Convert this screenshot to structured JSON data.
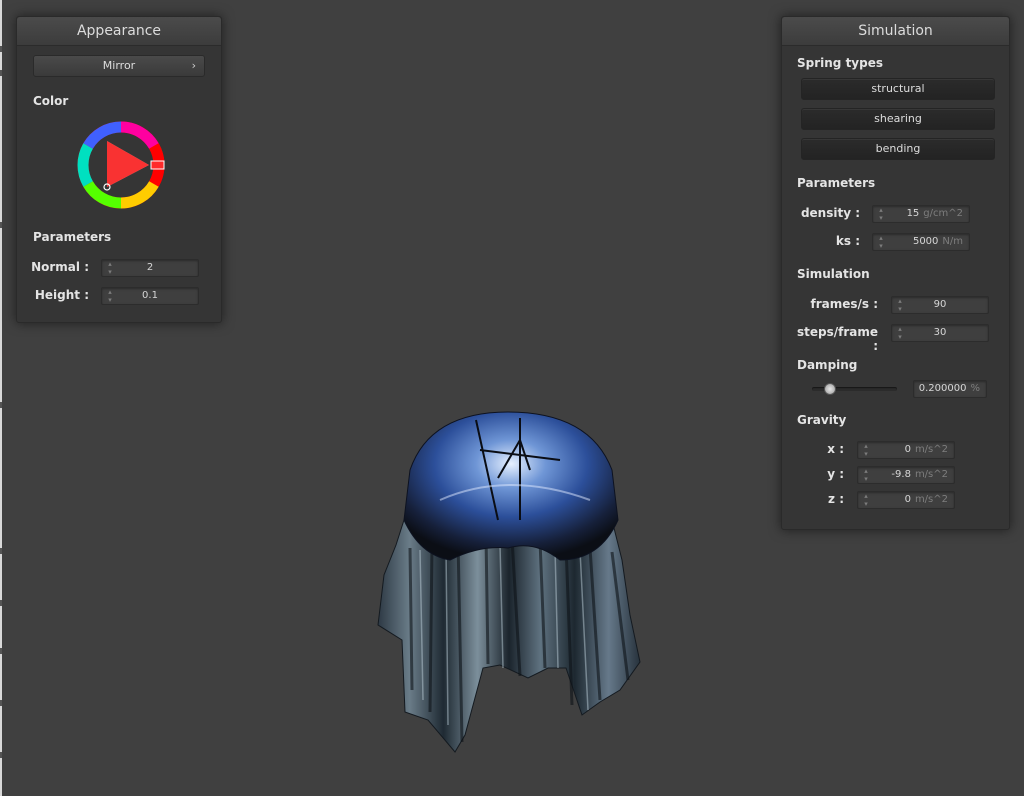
{
  "appearance": {
    "title": "Appearance",
    "shader_dropdown": "Mirror",
    "color_label": "Color",
    "color": "#ff0000",
    "parameters_label": "Parameters",
    "normal": {
      "label": "Normal :",
      "value": "2"
    },
    "height": {
      "label": "Height :",
      "value": "0.1"
    }
  },
  "simulation": {
    "title": "Simulation",
    "spring_types_label": "Spring types",
    "springs": {
      "structural": "structural",
      "shearing": "shearing",
      "bending": "bending"
    },
    "parameters_label": "Parameters",
    "density": {
      "label": "density :",
      "value": "15",
      "unit": "g/cm^2"
    },
    "ks": {
      "label": "ks :",
      "value": "5000",
      "unit": "N/m"
    },
    "simulation_label": "Simulation",
    "fps": {
      "label": "frames/s :",
      "value": "90"
    },
    "steps": {
      "label": "steps/frame :",
      "value": "30"
    },
    "damping_label": "Damping",
    "damping": {
      "value": "0.200000",
      "unit": "%",
      "fraction": 0.2
    },
    "gravity_label": "Gravity",
    "gx": {
      "label": "x :",
      "value": "0",
      "unit": "m/s^2"
    },
    "gy": {
      "label": "y :",
      "value": "-9.8",
      "unit": "m/s^2"
    },
    "gz": {
      "label": "z :",
      "value": "0",
      "unit": "m/s^2"
    }
  },
  "icons": {
    "dropdown": "chevron-right-icon",
    "spinner": "spinner-arrows-icon"
  },
  "colors": {
    "background": "#404040",
    "panel": "#353535"
  }
}
